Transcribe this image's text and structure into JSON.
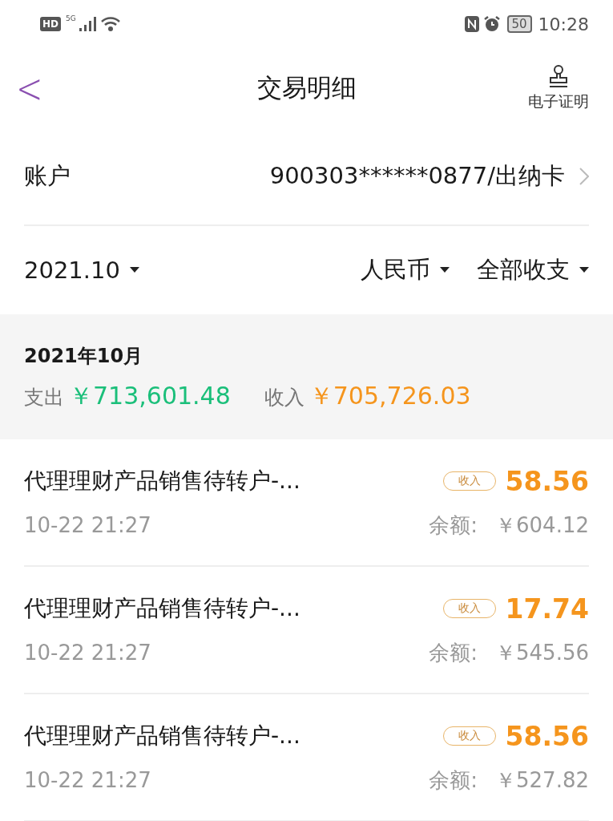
{
  "status_bar": {
    "hd": "HD",
    "network": "5G",
    "battery": "50",
    "time": "10:28"
  },
  "header": {
    "back": "<",
    "title": "交易明细",
    "action": "电子证明"
  },
  "account": {
    "label": "账户",
    "value": "900303******0877/出纳卡"
  },
  "filters": [
    {
      "label": "2021.10"
    },
    {
      "label": "人民币"
    },
    {
      "label": "全部收支"
    }
  ],
  "summary": {
    "month": "2021年10月",
    "expense_label": "支出",
    "expense": "￥713,601.48",
    "income_label": "收入",
    "income": "￥705,726.03"
  },
  "transactions": [
    {
      "title": "代理理财产品销售待转户-...",
      "time": "10-22 21:27",
      "kind": "income",
      "tag": "收入",
      "amount": "58.56",
      "balance_label": "余额:",
      "balance": "￥604.12"
    },
    {
      "title": "代理理财产品销售待转户-...",
      "time": "10-22 21:27",
      "kind": "income",
      "tag": "收入",
      "amount": "17.74",
      "balance_label": "余额:",
      "balance": "￥545.56"
    },
    {
      "title": "代理理财产品销售待转户-...",
      "time": "10-22 21:27",
      "kind": "income",
      "tag": "收入",
      "amount": "58.56",
      "balance_label": "余额:",
      "balance": "￥527.82"
    }
  ]
}
